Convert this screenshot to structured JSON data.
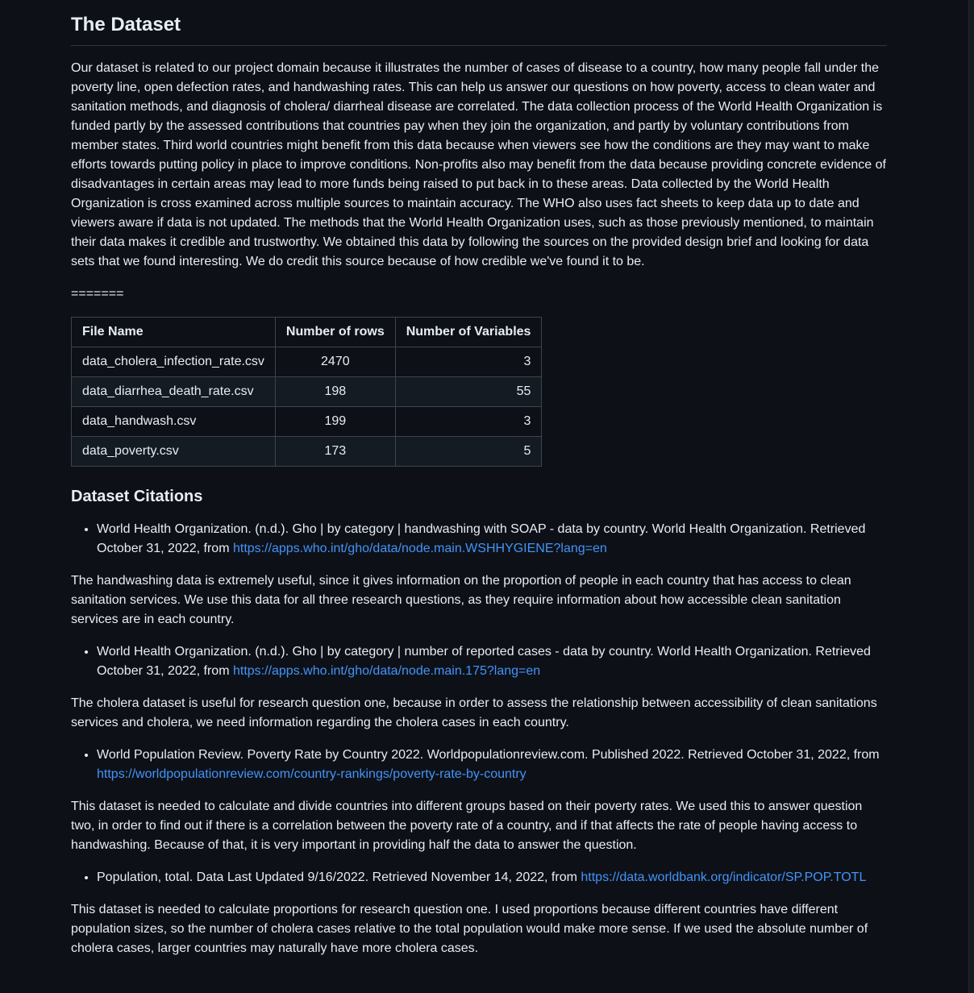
{
  "heading": "The Dataset",
  "intro": "Our dataset is related to our project domain because it illustrates the number of cases of disease to a country, how many people fall under the poverty line, open defection rates, and handwashing rates. This can help us answer our questions on how poverty, access to clean water and sanitation methods, and diagnosis of cholera/ diarrheal disease are correlated. The data collection process of the World Health Organization is funded partly by the assessed contributions that countries pay when they join the organization, and partly by voluntary contributions from member states. Third world countries might benefit from this data because when viewers see how the conditions are they may want to make efforts towards putting policy in place to improve conditions. Non-profits also may benefit from the data because providing concrete evidence of disadvantages in certain areas may lead to more funds being raised to put back in to these areas. Data collected by the World Health Organization is cross examined across multiple sources to maintain accuracy. The WHO also uses fact sheets to keep data up to date and viewers aware if data is not updated. The methods that the World Health Organization uses, such as those previously mentioned, to maintain their data makes it credible and trustworthy. We obtained this data by following the sources on the provided design brief and looking for data sets that we found interesting. We do credit this source because of how credible we've found it to be.",
  "separator": "=======",
  "table": {
    "headers": [
      "File Name",
      "Number of rows",
      "Number of Variables"
    ],
    "rows": [
      [
        "data_cholera_infection_rate.csv",
        "2470",
        "3"
      ],
      [
        "data_diarrhea_death_rate.csv",
        "198",
        "55"
      ],
      [
        "data_handwash.csv",
        "199",
        "3"
      ],
      [
        "data_poverty.csv",
        "173",
        "5"
      ]
    ]
  },
  "citations_heading": "Dataset Citations",
  "citations": [
    {
      "text": "World Health Organization. (n.d.). Gho | by category | handwashing with SOAP - data by country. World Health Organization. Retrieved October 31, 2022, from ",
      "link": "https://apps.who.int/gho/data/node.main.WSHHYGIENE?lang=en",
      "description": "The handwashing data is extremely useful, since it gives information on the proportion of people in each country that has access to clean sanitation services. We use this data for all three research questions, as they require information about how accessible clean sanitation services are in each country."
    },
    {
      "text": "World Health Organization. (n.d.). Gho | by category | number of reported cases - data by country. World Health Organization. Retrieved October 31, 2022, from ",
      "link": "https://apps.who.int/gho/data/node.main.175?lang=en",
      "description": "The cholera dataset is useful for research question one, because in order to assess the relationship between accessibility of clean sanitations services and cholera, we need information regarding the cholera cases in each country."
    },
    {
      "text": "World Population Review. Poverty Rate by Country 2022. Worldpopulationreview.com. Published 2022. Retrieved October 31, 2022, from ",
      "link": "https://worldpopulationreview.com/country-rankings/poverty-rate-by-country",
      "description": "This dataset is needed to calculate and divide countries into different groups based on their poverty rates. We used this to answer question two, in order to find out if there is a correlation between the poverty rate of a country, and if that affects the rate of people having access to handwashing. Because of that, it is very important in providing half the data to answer the question."
    },
    {
      "text": "Population, total. Data Last Updated 9/16/2022. Retrieved November 14, 2022, from ",
      "link": "https://data.worldbank.org/indicator/SP.POP.TOTL",
      "description": "This dataset is needed to calculate proportions for research question one. I used proportions because different countries have different population sizes, so the number of cholera cases relative to the total population would make more sense. If we used the absolute number of cholera cases, larger countries may naturally have more cholera cases."
    }
  ]
}
